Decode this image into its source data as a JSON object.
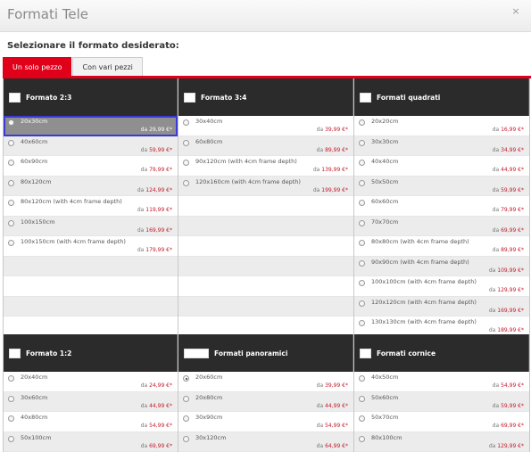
{
  "window": {
    "title": "Formati Tele",
    "close_glyph": "×"
  },
  "prompt": "Selezionare il formato desiderato:",
  "tabs": [
    {
      "label": "Un solo pezzo",
      "active": true
    },
    {
      "label": "Con vari pezzi",
      "active": false
    }
  ],
  "top_group": [
    {
      "heading": "Formato 2:3",
      "items": [
        {
          "label": "20x30cm",
          "price_prefix": "da",
          "price": "29,99 €*",
          "selected": true
        },
        {
          "label": "40x60cm",
          "price_prefix": "da",
          "price": "59,99 €*"
        },
        {
          "label": "60x90cm",
          "price_prefix": "da",
          "price": "79,99 €*"
        },
        {
          "label": "80x120cm",
          "price_prefix": "da",
          "price": "124,99 €*"
        },
        {
          "label": "80x120cm (with 4cm frame depth)",
          "price_prefix": "da",
          "price": "119,99 €*"
        },
        {
          "label": "100x150cm",
          "price_prefix": "da",
          "price": "169,99 €*"
        },
        {
          "label": "100x150cm (with 4cm frame depth)",
          "price_prefix": "da",
          "price": "179,99 €*"
        }
      ]
    },
    {
      "heading": "Formato 3:4",
      "items": [
        {
          "label": "30x40cm",
          "price_prefix": "da",
          "price": "39,99 €*"
        },
        {
          "label": "60x80cm",
          "price_prefix": "da",
          "price": "89,99 €*"
        },
        {
          "label": "90x120cm (with 4cm frame depth)",
          "price_prefix": "da",
          "price": "139,99 €*"
        },
        {
          "label": "120x160cm (with 4cm frame depth)",
          "price_prefix": "da",
          "price": "199,99 €*"
        }
      ]
    },
    {
      "heading": "Formati quadrati",
      "items": [
        {
          "label": "20x20cm",
          "price_prefix": "da",
          "price": "16,99 €*"
        },
        {
          "label": "30x30cm",
          "price_prefix": "da",
          "price": "34,99 €*"
        },
        {
          "label": "40x40cm",
          "price_prefix": "da",
          "price": "44,99 €*"
        },
        {
          "label": "50x50cm",
          "price_prefix": "da",
          "price": "59,99 €*"
        },
        {
          "label": "60x60cm",
          "price_prefix": "da",
          "price": "79,99 €*"
        },
        {
          "label": "70x70cm",
          "price_prefix": "da",
          "price": "69,99 €*"
        },
        {
          "label": "80x80cm (with 4cm frame depth)",
          "price_prefix": "da",
          "price": "89,99 €*"
        },
        {
          "label": "90x90cm (with 4cm frame depth)",
          "price_prefix": "da",
          "price": "109,99 €*"
        },
        {
          "label": "100x100cm (with 4cm frame depth)",
          "price_prefix": "da",
          "price": "129,99 €*"
        },
        {
          "label": "120x120cm (with 4cm frame depth)",
          "price_prefix": "da",
          "price": "169,99 €*"
        },
        {
          "label": "130x130cm (with 4cm frame depth)",
          "price_prefix": "da",
          "price": "189,99 €*"
        }
      ]
    }
  ],
  "bottom_group": [
    {
      "heading": "Formato 1:2",
      "items": [
        {
          "label": "20x40cm",
          "price_prefix": "da",
          "price": "24,99 €*"
        },
        {
          "label": "30x60cm",
          "price_prefix": "da",
          "price": "44,99 €*"
        },
        {
          "label": "40x80cm",
          "price_prefix": "da",
          "price": "54,99 €*"
        },
        {
          "label": "50x100cm",
          "price_prefix": "da",
          "price": "69,99 €*"
        }
      ]
    },
    {
      "heading": "Formati panoramici",
      "items": [
        {
          "label": "20x60cm",
          "price_prefix": "da",
          "price": "39,99 €*",
          "checked": true
        },
        {
          "label": "20x80cm",
          "price_prefix": "da",
          "price": "44,99 €*"
        },
        {
          "label": "30x90cm",
          "price_prefix": "da",
          "price": "54,99 €*"
        },
        {
          "label": "30x120cm",
          "price_prefix": "da",
          "price": "64,99 €*"
        }
      ]
    },
    {
      "heading": "Formati cornice",
      "items": [
        {
          "label": "40x50cm",
          "price_prefix": "da",
          "price": "54,99 €*"
        },
        {
          "label": "50x60cm",
          "price_prefix": "da",
          "price": "59,99 €*"
        },
        {
          "label": "50x70cm",
          "price_prefix": "da",
          "price": "69,99 €*"
        },
        {
          "label": "80x100cm",
          "price_prefix": "da",
          "price": "129,99 €*"
        }
      ]
    }
  ]
}
